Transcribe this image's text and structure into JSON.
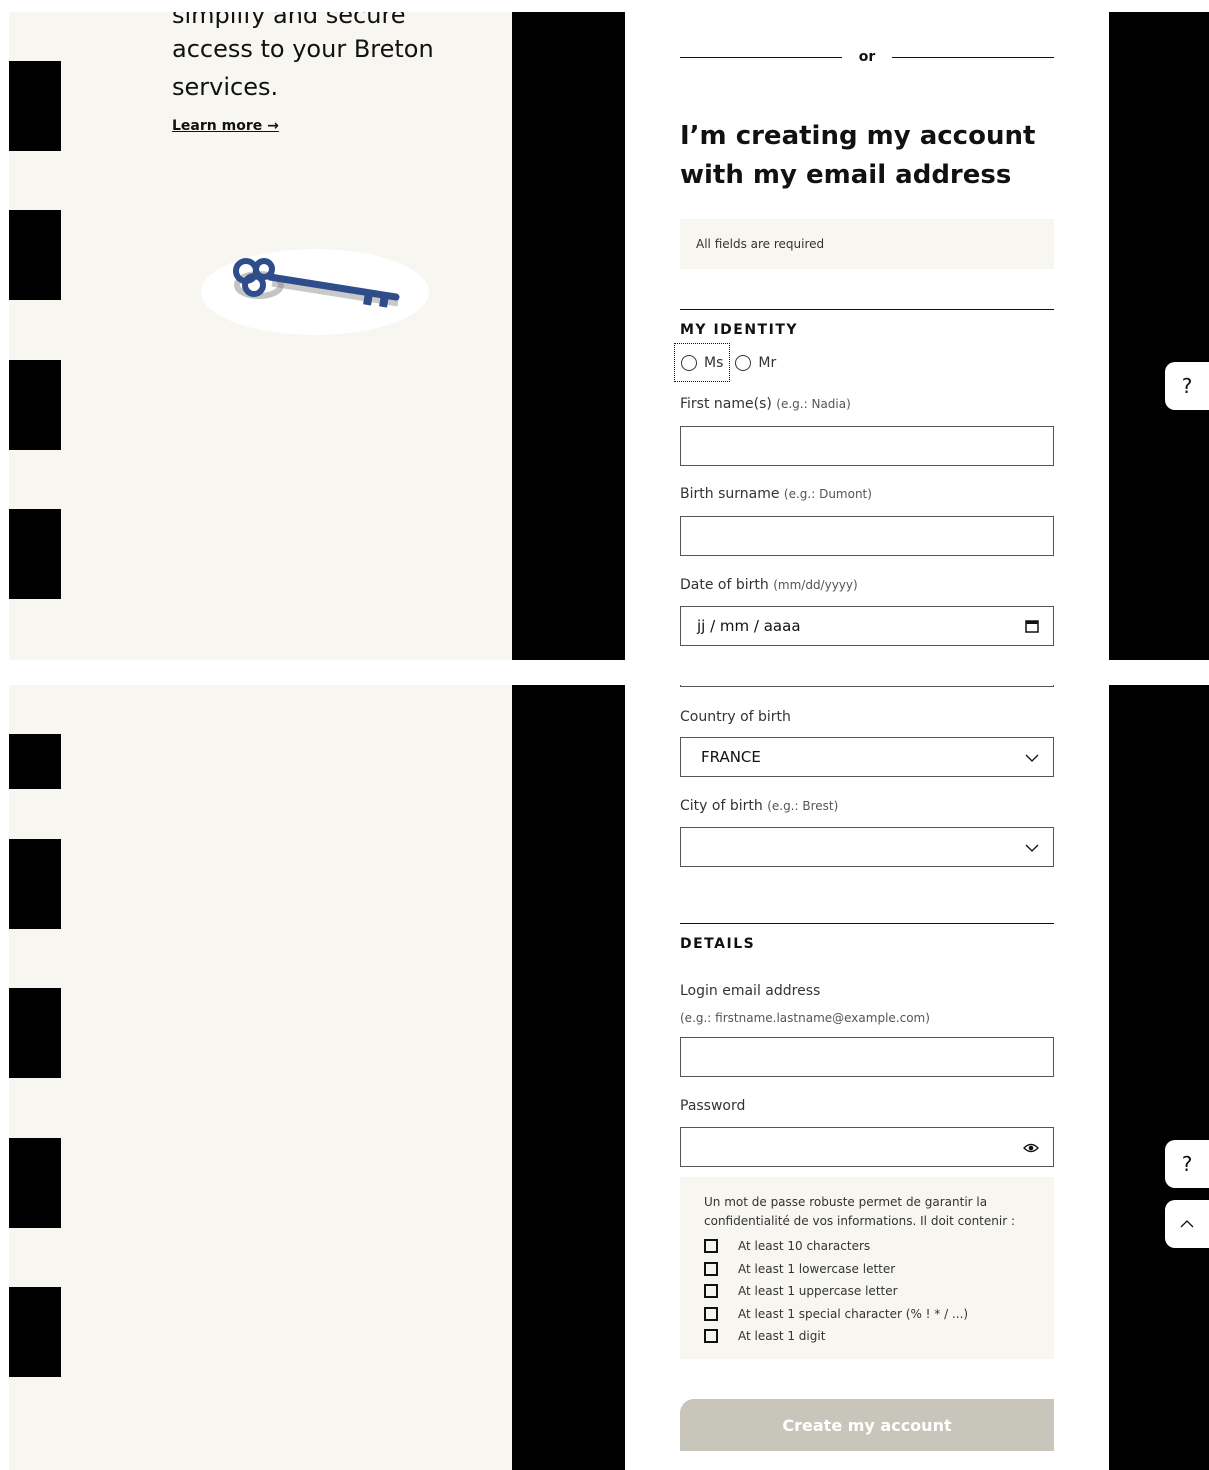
{
  "promo": {
    "line1": "simplify and secure",
    "line2": "access to your Breton",
    "line3": "services.",
    "learn_more": "Learn more →"
  },
  "divider_or": "or",
  "heading": "I’m creating my account with my email address",
  "required_note": "All fields are required",
  "identity": {
    "title": "MY IDENTITY",
    "radio_ms": "Ms",
    "radio_mr": "Mr",
    "first_name_label": "First name(s)",
    "first_name_hint": "(e.g.: Nadia)",
    "surname_label": "Birth surname",
    "surname_hint": "(e.g.: Dumont)",
    "dob_label": "Date of birth",
    "dob_hint": "(mm/dd/yyyy)",
    "dob_value": "jj / mm / aaaa",
    "country_label": "Country of birth",
    "country_value": "FRANCE",
    "city_label": "City of birth",
    "city_hint": "(e.g.: Brest)"
  },
  "details": {
    "title": "DETAILS",
    "email_label": "Login email address",
    "email_hint": "(e.g.: firstname.lastname@example.com)",
    "password_label": "Password"
  },
  "password_rules": {
    "intro": "Un mot de passe robuste permet de garantir la confidentialité de vos informations. Il doit contenir :",
    "rules": [
      "At least 10 characters",
      "At least 1 lowercase letter",
      "At least 1 uppercase letter",
      "At least 1 special character (% ! * / ...)",
      "At least 1 digit"
    ]
  },
  "submit_label": "Create my account",
  "help_label": "?",
  "colors": {
    "cream": "#f7f6f1",
    "button_disabled": "#c8c6bb",
    "key_blue": "#2f4d8a"
  }
}
